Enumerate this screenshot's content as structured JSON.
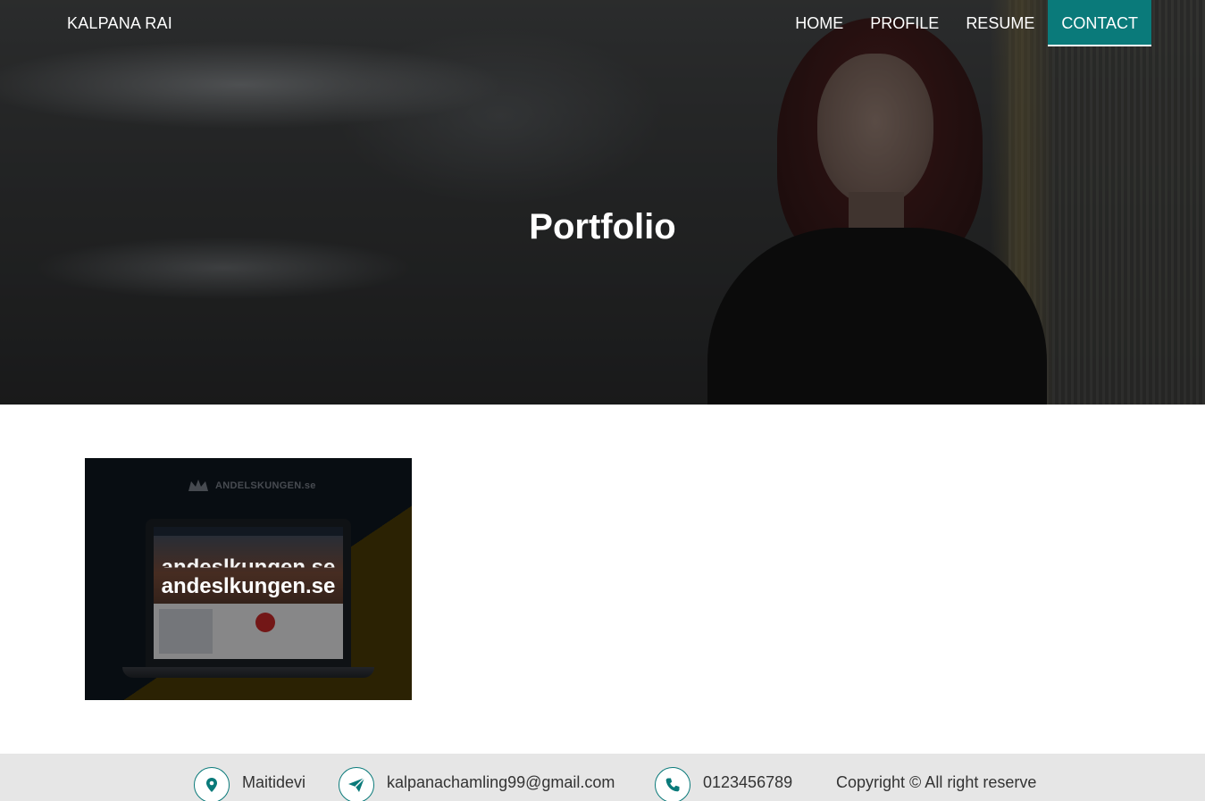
{
  "header": {
    "brand": "KALPANA RAI",
    "nav": [
      {
        "label": "HOME",
        "active": false
      },
      {
        "label": "PROFILE",
        "active": false
      },
      {
        "label": "RESUME",
        "active": false
      },
      {
        "label": "CONTACT",
        "active": true
      }
    ]
  },
  "hero": {
    "title": "Portfolio"
  },
  "portfolio": {
    "items": [
      {
        "title": "andeslkungen.se",
        "thumbnail_logo": "ANDELSKUNGEN.se"
      }
    ]
  },
  "footer": {
    "location": "Maitidevi",
    "email": "kalpanachamling99@gmail.com",
    "phone": "0123456789",
    "copyright": "Copyright © All right reserve",
    "icons": [
      "map-marker-icon",
      "paper-plane-icon",
      "phone-icon"
    ]
  },
  "colors": {
    "accent": "#0a7a7a",
    "footer_bg": "#e6e6e6",
    "text_dark": "#333333"
  }
}
